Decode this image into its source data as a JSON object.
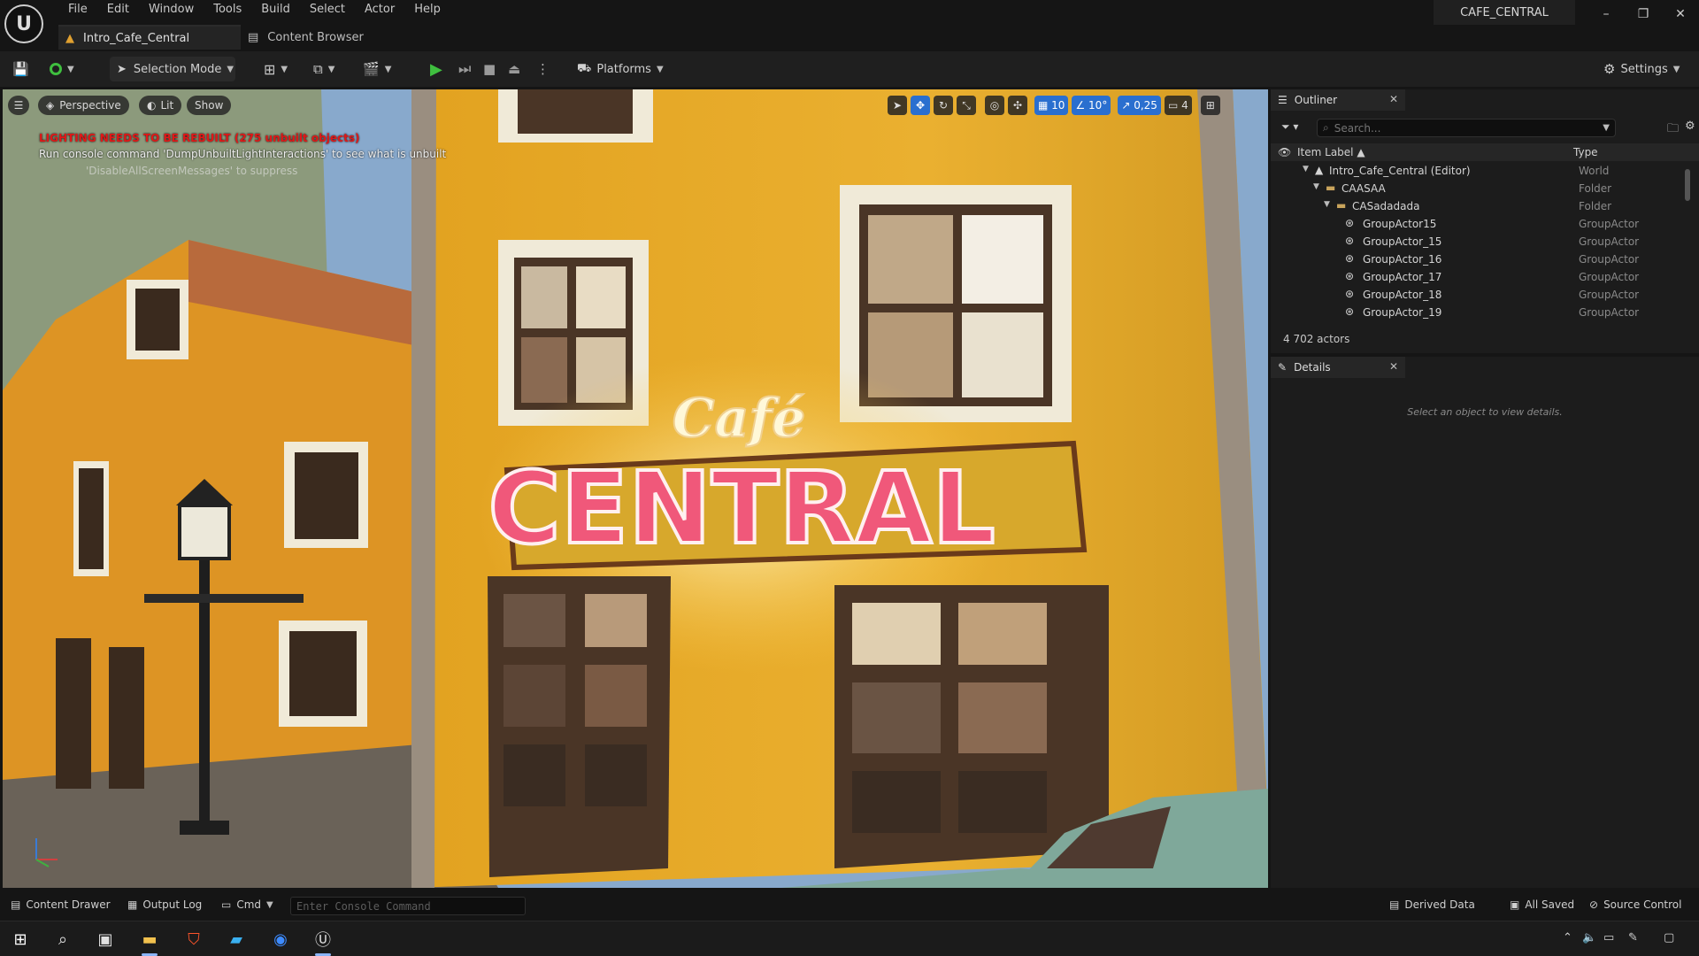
{
  "menu": {
    "items": [
      "File",
      "Edit",
      "Window",
      "Tools",
      "Build",
      "Select",
      "Actor",
      "Help"
    ]
  },
  "tabs": {
    "level_tab": "Intro_Cafe_Central",
    "content_browser_tab": "Content Browser"
  },
  "project_name": "CAFE_CENTRAL",
  "toolbar": {
    "selection_mode": "Selection Mode",
    "platforms": "Platforms",
    "settings": "Settings"
  },
  "viewport": {
    "perspective": "Perspective",
    "lit": "Lit",
    "show": "Show",
    "grid_snap": "10",
    "rotation_snap": "10°",
    "scale_snap": "0,25",
    "camera_speed": "4",
    "warning_line1": "LIGHTING NEEDS TO BE REBUILT (275 unbuilt objects)",
    "warning_line2": "Run console command 'DumpUnbuiltLightInteractions' to see what is unbuilt",
    "warning_line3": "'DisableAllScreenMessages' to suppress",
    "sign_script": "Café",
    "sign_main": "CENTRAL"
  },
  "outliner": {
    "title": "Outliner",
    "search_placeholder": "Search...",
    "col_label": "Item Label",
    "col_type": "Type",
    "rows": [
      {
        "label": "Intro_Cafe_Central (Editor)",
        "type": "World"
      },
      {
        "label": "CAASAA",
        "type": "Folder"
      },
      {
        "label": "CASadadada",
        "type": "Folder"
      },
      {
        "label": "GroupActor15",
        "type": "GroupActor"
      },
      {
        "label": "GroupActor_15",
        "type": "GroupActor"
      },
      {
        "label": "GroupActor_16",
        "type": "GroupActor"
      },
      {
        "label": "GroupActor_17",
        "type": "GroupActor"
      },
      {
        "label": "GroupActor_18",
        "type": "GroupActor"
      },
      {
        "label": "GroupActor_19",
        "type": "GroupActor"
      }
    ],
    "actor_count": "4 702 actors"
  },
  "details": {
    "title": "Details",
    "empty_message": "Select an object to view details."
  },
  "statusbar": {
    "content_drawer": "Content Drawer",
    "output_log": "Output Log",
    "cmd": "Cmd",
    "console_placeholder": "Enter Console Command",
    "derived_data": "Derived Data",
    "all_saved": "All Saved",
    "source_control": "Source Control"
  },
  "colors": {
    "accent_blue": "#2a6fcf",
    "play_green": "#3fbf3f",
    "warning_red": "#e01818",
    "sign_pink": "#f0587a"
  }
}
